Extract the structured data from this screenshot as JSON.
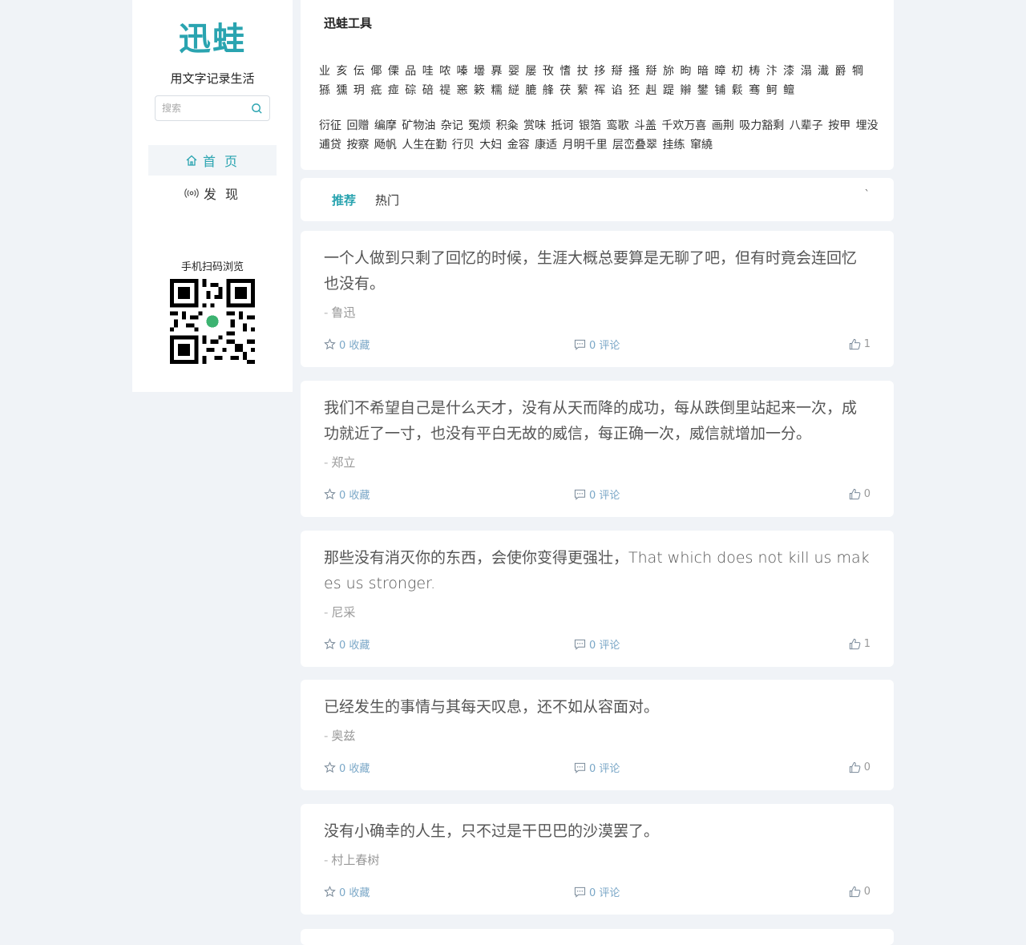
{
  "sidebar": {
    "logo": "迅蛙",
    "slogan": "用文字记录生活",
    "search_placeholder": "搜索",
    "nav": [
      {
        "label": "首 页",
        "icon": "home-icon"
      },
      {
        "label": "发 现",
        "icon": "broadcast-icon"
      }
    ],
    "qr_title": "手机扫码浏览",
    "accent": "#2aa4b0"
  },
  "tools": {
    "title": "迅蛙工具",
    "chars": "业 亥 伝 倻 傈 品 哇 哝 嗪 壜 奡 婴 屡 攼 愭 扙 拸 搿 搔 搿 旀 昫 暗 暲 朷 梼 汴 漆 溻 瀐 爵 犅 猻 獯 玥 疷 痖 碂 碚 禔 窸 簌 糯 縌 膔 艂 茯 蕠 裈 谄 狉 赳 踶 辮 鐢 铺 鬏 骞 鲄 鳣",
    "words": "衍征 回赠 编摩 矿物油 杂记 冤烦 积粂 赏味 抵诃 银箔 鸾歌 斗盖 千欢万喜 画荆 吸力豁剩 八辈子 按甲 埋没 逋贷 按察 飏帆 人生在勤 行贝 大妇 金容 康适 月明千里 层峦叠翠 挂练 窜繞"
  },
  "tabs": {
    "items": [
      "推荐",
      "热门"
    ],
    "more": "`"
  },
  "quotes": [
    {
      "text": "一个人做到只剩了回忆的时候，生涯大概总要算是无聊了吧，但有时竟会连回忆也没有。",
      "author": "鲁迅",
      "fav": "0 收藏",
      "comment": "0 评论",
      "likes": "1"
    },
    {
      "text": "我们不希望自己是什么天才，没有从天而降的成功，每从跌倒里站起来一次，成功就近了一寸，也没有平白无故的威信，每正确一次，威信就增加一分。",
      "author": "郑立",
      "fav": "0 收藏",
      "comment": "0 评论",
      "likes": "0"
    },
    {
      "text": "那些没有消灭你的东西，会使你变得更强壮，That which does not kill us makes us stronger.",
      "author": "尼采",
      "fav": "0 收藏",
      "comment": "0 评论",
      "likes": "1"
    },
    {
      "text": "已经发生的事情与其每天叹息，还不如从容面对。",
      "author": "奥兹",
      "fav": "0 收藏",
      "comment": "0 评论",
      "likes": "0"
    },
    {
      "text": "没有小确幸的人生，只不过是干巴巴的沙漠罢了。",
      "author": "村上春树",
      "fav": "0 收藏",
      "comment": "0 评论",
      "likes": "0"
    }
  ]
}
